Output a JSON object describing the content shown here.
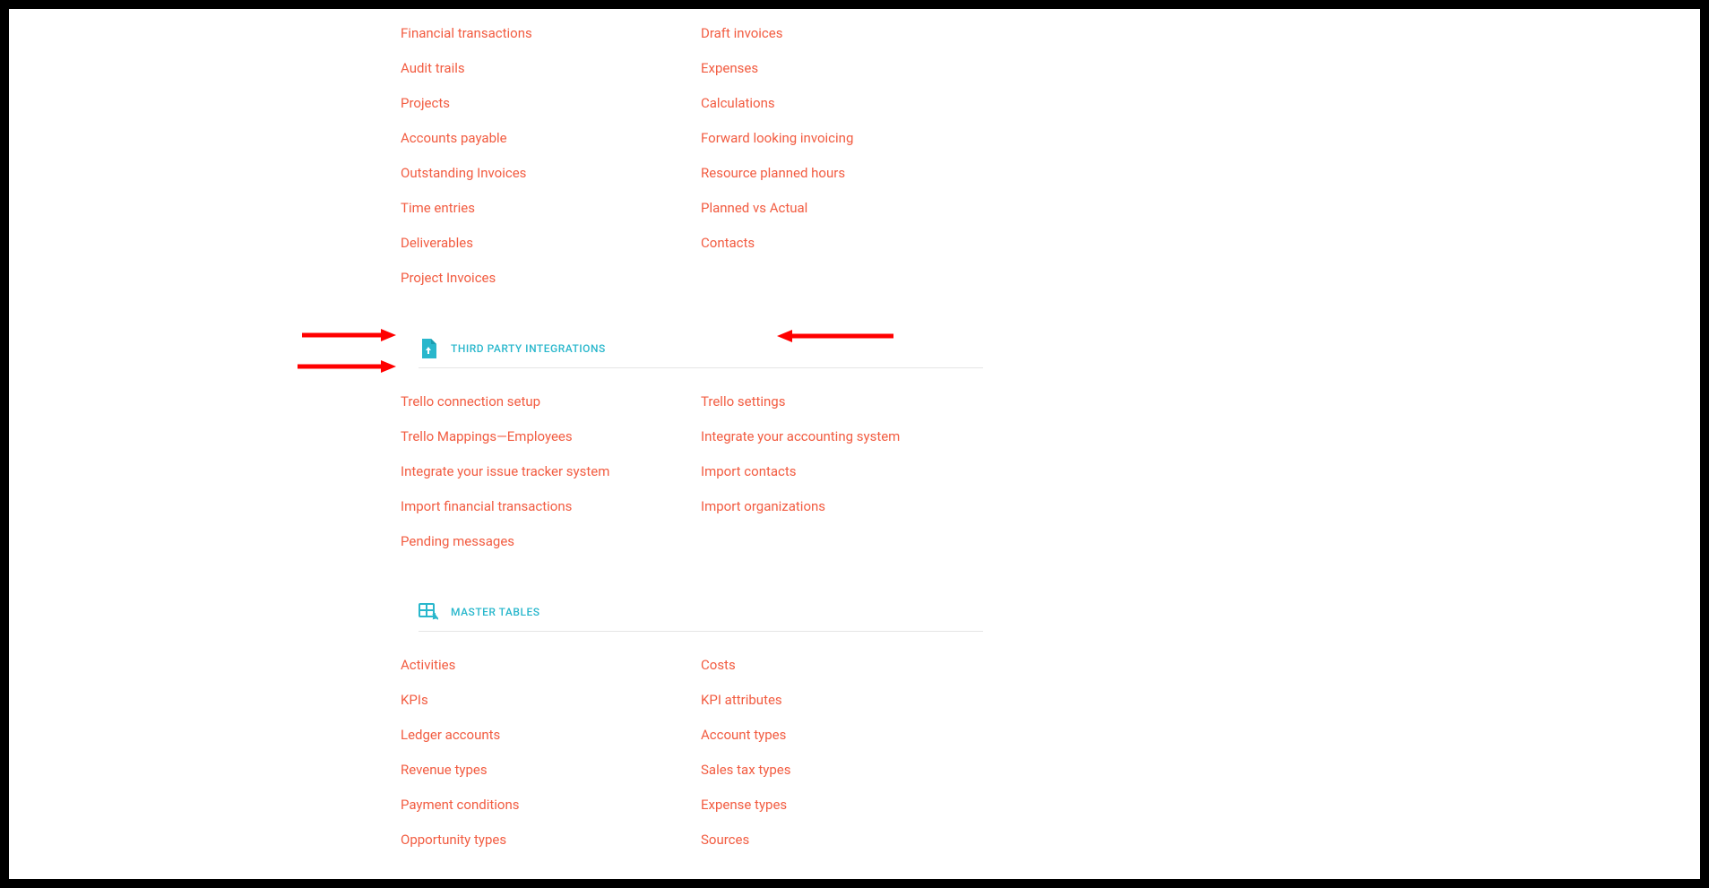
{
  "sections": {
    "top_partial": {
      "col1": [
        "Financial transactions",
        "Audit trails",
        "Projects",
        "Accounts payable",
        "Outstanding Invoices",
        "Time entries",
        "Deliverables",
        "Project Invoices"
      ],
      "col2": [
        "Draft invoices",
        "Expenses",
        "Calculations",
        "Forward looking invoicing",
        "Resource planned hours",
        "Planned vs Actual",
        "Contacts"
      ]
    },
    "integrations": {
      "title": "THIRD PARTY INTEGRATIONS",
      "col1": [
        "Trello connection setup",
        "Trello Mappings—Employees",
        "Integrate your issue tracker system",
        "Import financial transactions",
        "Pending messages"
      ],
      "col2": [
        "Trello settings",
        "Integrate your accounting system",
        "Import contacts",
        "Import organizations"
      ]
    },
    "master": {
      "title": "MASTER TABLES",
      "col1": [
        "Activities",
        "KPIs",
        "Ledger accounts",
        "Revenue types",
        "Payment conditions",
        "Opportunity types"
      ],
      "col2": [
        "Costs",
        "KPI attributes",
        "Account types",
        "Sales tax types",
        "Expense types",
        "Sources"
      ]
    }
  },
  "annotations": {
    "arrow_color": "#ff0000",
    "arrows": [
      {
        "target": "Trello connection setup",
        "direction": "right"
      },
      {
        "target": "Trello Mappings—Employees",
        "direction": "right"
      },
      {
        "target": "Trello settings",
        "direction": "left"
      }
    ]
  }
}
